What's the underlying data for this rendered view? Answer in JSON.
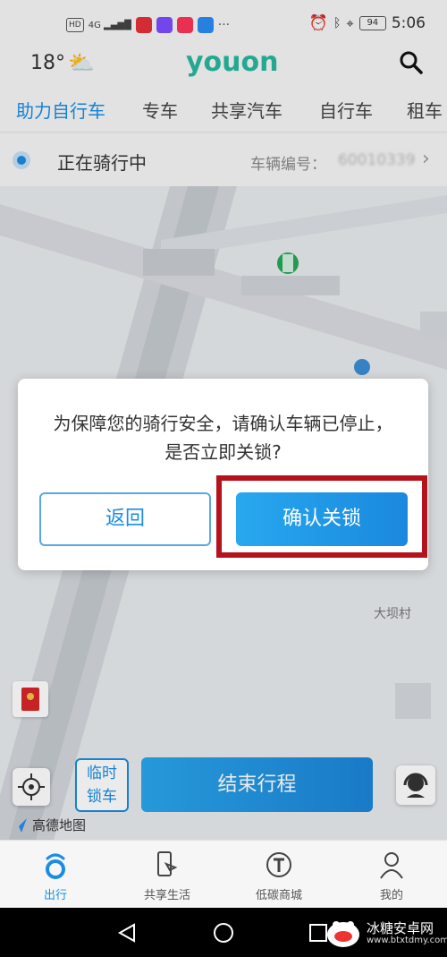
{
  "status_bar": {
    "time": "5:06",
    "battery": "94",
    "network": "4G",
    "hd": "HD",
    "icons": [
      "alarm-icon",
      "bluetooth-icon",
      "location-icon"
    ]
  },
  "header": {
    "temperature": "18°",
    "weather_icon": "partly-cloudy-icon",
    "logo": "youon"
  },
  "tabs": [
    {
      "label": "助力自行车",
      "active": true
    },
    {
      "label": "专车",
      "active": false
    },
    {
      "label": "共享汽车",
      "active": false
    },
    {
      "label": "自行车",
      "active": false
    },
    {
      "label": "租车",
      "active": false
    }
  ],
  "ride": {
    "status": "正在骑行中",
    "vehicle_label": "车辆编号：",
    "vehicle_number": "60010339"
  },
  "dialog": {
    "message_line1": "为保障您的骑行安全，请确认车辆已停止，",
    "message_line2": "是否立即关锁?",
    "back_label": "返回",
    "confirm_label": "确认关锁"
  },
  "map": {
    "temp_lock_line1": "临时",
    "temp_lock_line2": "锁车",
    "end_trip_label": "结束行程",
    "provider_label": "高德地图",
    "village_label": "大坝村"
  },
  "bottom_nav": [
    {
      "label": "出行",
      "active": true
    },
    {
      "label": "共享生活",
      "active": false
    },
    {
      "label": "低碳商城",
      "active": false
    },
    {
      "label": "我的",
      "active": false
    }
  ],
  "watermark": {
    "title": "冰糖安卓网",
    "url": "www.btxtdmy.com"
  },
  "colors": {
    "accent": "#1a8de3",
    "highlight_border": "#b5121b",
    "logo": "#29b79f"
  }
}
